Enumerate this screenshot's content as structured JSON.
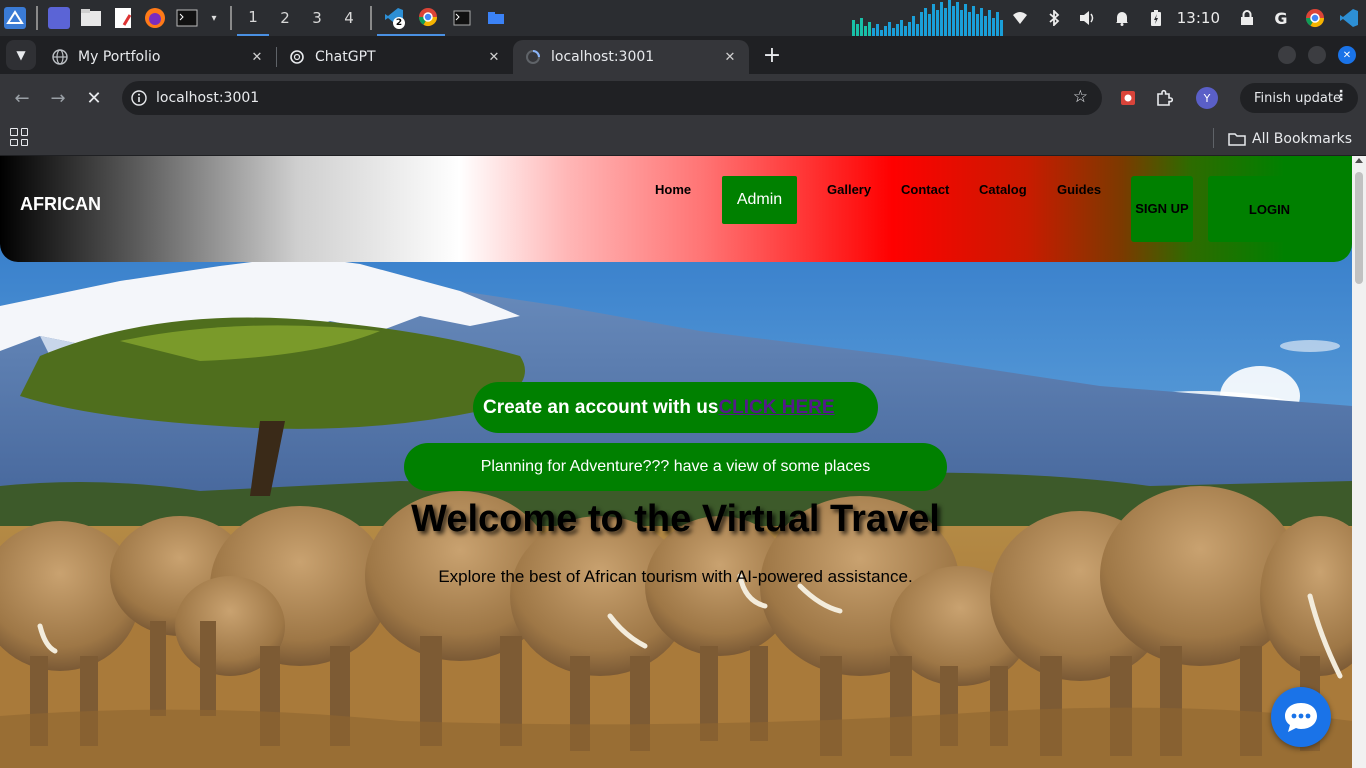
{
  "taskbar": {
    "workspaces": [
      "1",
      "2",
      "3",
      "4"
    ],
    "active_workspace": "1",
    "vscode_badge": "2",
    "clock": "13:10"
  },
  "browser": {
    "tabs": [
      {
        "title": "My Portfolio",
        "icon": "globe-icon"
      },
      {
        "title": "ChatGPT",
        "icon": "chatgpt-icon"
      },
      {
        "title": "localhost:3001",
        "icon": "loading-icon",
        "active": true
      }
    ],
    "url": "localhost:3001",
    "profile_initial": "Y",
    "finish_update_label": "Finish update",
    "bookmarks_label": "All Bookmarks"
  },
  "site": {
    "brand": "AFRICAN",
    "nav": {
      "home": "Home",
      "admin": "Admin",
      "gallery": "Gallery",
      "contact": "Contact",
      "catalog": "Catalog",
      "guides": "Guides",
      "signup": "SIGN UP",
      "login": "LOGIN"
    },
    "hero": {
      "cta_text": "Create an account with us",
      "cta_link": "CLICK HERE",
      "adventure": "Planning for Adventure??? have a view of some places",
      "welcome": "Welcome to the Virtual Travel",
      "subtitle": "Explore the best of African tourism with AI-powered assistance."
    }
  },
  "colors": {
    "accent_green": "#008000",
    "link_purple": "#551a8b",
    "chat_blue": "#1a73e8"
  }
}
